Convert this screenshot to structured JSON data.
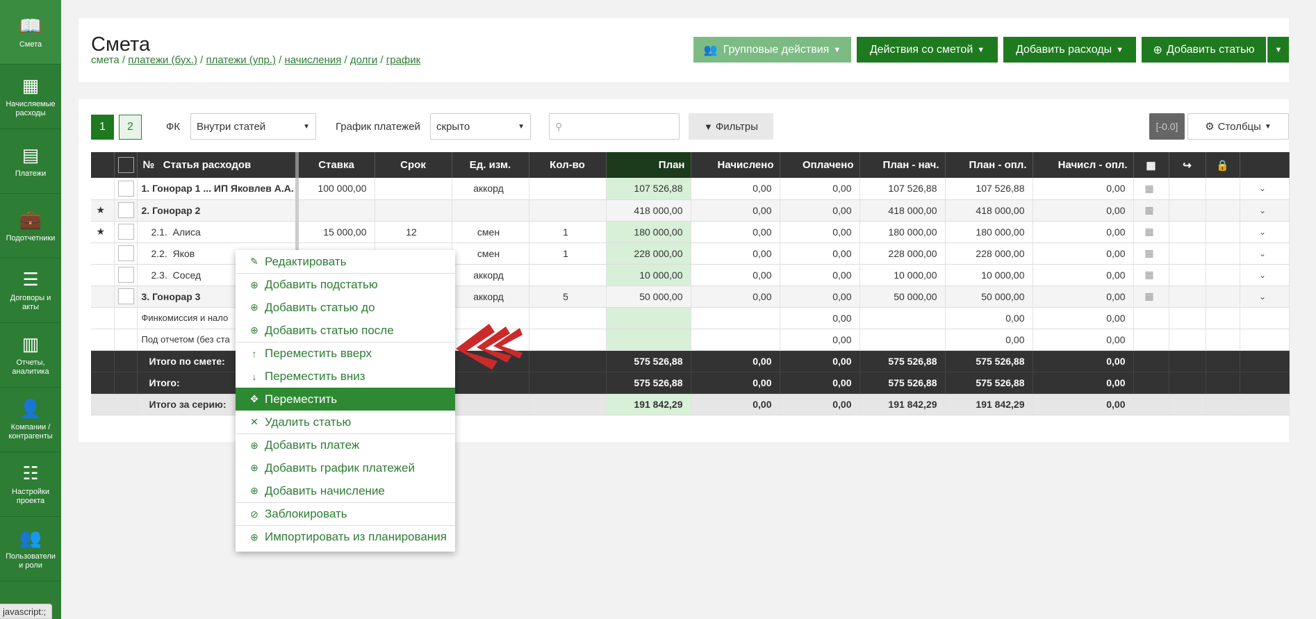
{
  "sidebar": {
    "items": [
      {
        "label": "Смета",
        "icon": "book-icon"
      },
      {
        "label": "Начисляемые расходы",
        "icon": "calendar-icon"
      },
      {
        "label": "Платежи",
        "icon": "list-box-icon"
      },
      {
        "label": "Подотчетники",
        "icon": "briefcase-icon"
      },
      {
        "label": "Договоры и акты",
        "icon": "list-icon"
      },
      {
        "label": "Отчеты, аналитика",
        "icon": "bar-chart-icon"
      },
      {
        "label": "Компании / контрагенты",
        "icon": "user-icon"
      },
      {
        "label": "Настройки проекта",
        "icon": "sliders-icon"
      },
      {
        "label": "Пользователи и роли",
        "icon": "users-icon"
      }
    ],
    "active_index": 0
  },
  "status_text": "javascript:;",
  "header": {
    "title": "Смета",
    "breadcrumb": {
      "current": "смета",
      "links": [
        "платежи (бух.)",
        "платежи (упр.)",
        "начисления",
        "долги",
        "график"
      ],
      "separator": "/"
    },
    "buttons": {
      "group": "Групповые действия",
      "estimate": "Действия со сметой",
      "expenses": "Добавить расходы",
      "add_item": "Добавить статью"
    }
  },
  "toolbar": {
    "pages": [
      "1",
      "2"
    ],
    "fk_label": "ФК",
    "fk_value": "Внутри статей",
    "schedule_label": "График платежей",
    "schedule_value": "скрыто",
    "search_placeholder": "",
    "filters_label": "Фильтры",
    "badge": "[-0.0]",
    "columns_label": "Столбцы"
  },
  "table": {
    "headers": {
      "num": "№",
      "name": "Статья расходов",
      "rate": "Ставка",
      "term": "Срок",
      "unit": "Ед. изм.",
      "qty": "Кол-во",
      "plan": "План",
      "accrued": "Начислено",
      "paid": "Оплачено",
      "plan_acc": "План - нач.",
      "plan_paid": "План - опл.",
      "acc_paid": "Начисл - опл."
    },
    "rows": [
      {
        "star": "",
        "name": "1. Гонорар 1 ... ИП Яковлев А.А.",
        "rate": "100 000,00",
        "term": "",
        "unit": "аккорд",
        "qty": "",
        "plan": "107 526,88",
        "accrued": "0,00",
        "paid": "0,00",
        "plan_acc": "107 526,88",
        "plan_paid": "107 526,88",
        "acc_paid": "0,00"
      },
      {
        "star": "★",
        "name": "2. Гонорар 2",
        "rate": "",
        "term": "",
        "unit": "",
        "qty": "",
        "plan": "418 000,00",
        "accrued": "0,00",
        "paid": "0,00",
        "plan_acc": "418 000,00",
        "plan_paid": "418 000,00",
        "acc_paid": "0,00"
      },
      {
        "star": "★",
        "name": "2.1.  Алиса",
        "rate": "15 000,00",
        "term": "12",
        "unit": "смен",
        "qty": "1",
        "plan": "180 000,00",
        "accrued": "0,00",
        "paid": "0,00",
        "plan_acc": "180 000,00",
        "plan_paid": "180 000,00",
        "acc_paid": "0,00"
      },
      {
        "star": "",
        "name": "2.2.  Яков",
        "rate": "",
        "term": "",
        "unit": "смен",
        "qty": "1",
        "plan": "228 000,00",
        "accrued": "0,00",
        "paid": "0,00",
        "plan_acc": "228 000,00",
        "plan_paid": "228 000,00",
        "acc_paid": "0,00"
      },
      {
        "star": "",
        "name": "2.3.  Сосед",
        "rate": "",
        "term": "",
        "unit": "аккорд",
        "qty": "",
        "plan": "10 000,00",
        "accrued": "0,00",
        "paid": "0,00",
        "plan_acc": "10 000,00",
        "plan_paid": "10 000,00",
        "acc_paid": "0,00"
      },
      {
        "star": "",
        "name": "3. Гонорар 3",
        "rate": "",
        "term": "",
        "unit": "аккорд",
        "qty": "5",
        "plan": "50 000,00",
        "accrued": "0,00",
        "paid": "0,00",
        "plan_acc": "50 000,00",
        "plan_paid": "50 000,00",
        "acc_paid": "0,00"
      }
    ],
    "extra_rows": [
      {
        "name": "Финкомиссия и нало",
        "paid": "0,00",
        "plan_paid": "0,00",
        "acc_paid": "0,00"
      },
      {
        "name": "Под отчетом (без ста",
        "paid": "0,00",
        "plan_paid": "0,00",
        "acc_paid": "0,00"
      }
    ],
    "totals": [
      {
        "name": "Итого по смете:",
        "plan": "575 526,88",
        "accrued": "0,00",
        "paid": "0,00",
        "plan_acc": "575 526,88",
        "plan_paid": "575 526,88",
        "acc_paid": "0,00"
      },
      {
        "name": "Итого:",
        "plan": "575 526,88",
        "accrued": "0,00",
        "paid": "0,00",
        "plan_acc": "575 526,88",
        "plan_paid": "575 526,88",
        "acc_paid": "0,00"
      },
      {
        "name": "Итого за серию:",
        "plan": "191 842,29",
        "accrued": "0,00",
        "paid": "0,00",
        "plan_acc": "191 842,29",
        "plan_paid": "191 842,29",
        "acc_paid": "0,00"
      }
    ]
  },
  "context_menu": {
    "items": [
      {
        "label": "Редактировать",
        "icon": "pencil-icon",
        "glyph": "✎",
        "sep": false
      },
      {
        "label": "Добавить подстатью",
        "icon": "plus-circle-icon",
        "glyph": "⊕",
        "sep": true
      },
      {
        "label": "Добавить статью до",
        "icon": "plus-circle-icon",
        "glyph": "⊕",
        "sep": false
      },
      {
        "label": "Добавить статью после",
        "icon": "plus-circle-icon",
        "glyph": "⊕",
        "sep": false
      },
      {
        "label": "Переместить вверх",
        "icon": "arrow-up-icon",
        "glyph": "↑",
        "sep": true
      },
      {
        "label": "Переместить вниз",
        "icon": "arrow-down-icon",
        "glyph": "↓",
        "sep": false
      },
      {
        "label": "Переместить",
        "icon": "move-icon",
        "glyph": "✥",
        "sep": false,
        "active": true
      },
      {
        "label": "Удалить статью",
        "icon": "x-icon",
        "glyph": "✕",
        "sep": false
      },
      {
        "label": "Добавить платеж",
        "icon": "plus-circle-icon",
        "glyph": "⊕",
        "sep": true
      },
      {
        "label": "Добавить график платежей",
        "icon": "plus-circle-icon",
        "glyph": "⊕",
        "sep": false
      },
      {
        "label": "Добавить начисление",
        "icon": "plus-circle-icon",
        "glyph": "⊕",
        "sep": false
      },
      {
        "label": "Заблокировать",
        "icon": "ban-icon",
        "glyph": "⊘",
        "sep": true
      },
      {
        "label": "Импортировать из планирования",
        "icon": "plus-circle-icon",
        "glyph": "⊕",
        "sep": true
      }
    ]
  },
  "colors": {
    "brand_green": "#2d7d34",
    "button_green": "#1e7a1e",
    "button_light_green": "#7cbb83",
    "plan_column": "#d8efd8",
    "annotation_arrow": "#cc2a2a"
  }
}
